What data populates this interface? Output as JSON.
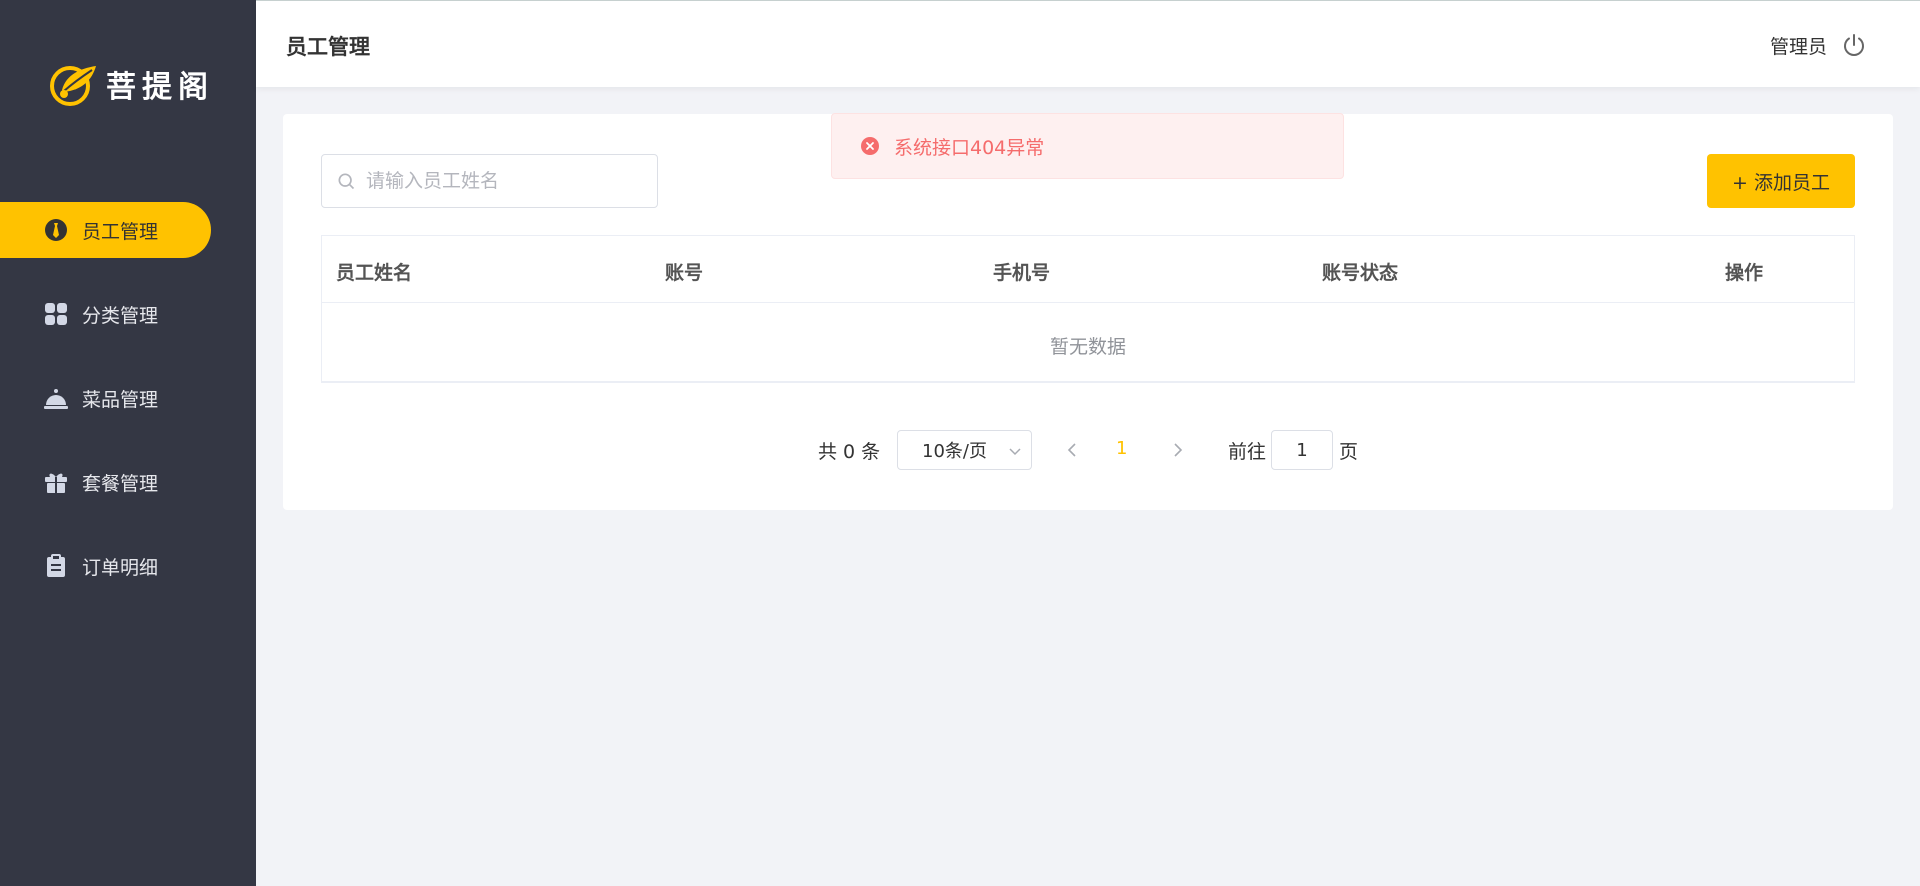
{
  "brand": {
    "name": "菩提阁",
    "accent": "#ffc200"
  },
  "sidebar": {
    "items": [
      {
        "label": "员工管理",
        "icon": "tie-icon",
        "active": true
      },
      {
        "label": "分类管理",
        "icon": "grid-icon",
        "active": false
      },
      {
        "label": "菜品管理",
        "icon": "cloche-icon",
        "active": false
      },
      {
        "label": "套餐管理",
        "icon": "gift-icon",
        "active": false
      },
      {
        "label": "订单明细",
        "icon": "clipboard-icon",
        "active": false
      }
    ]
  },
  "header": {
    "title": "员工管理",
    "user": "管理员",
    "logout_icon": "power-icon"
  },
  "toolbar": {
    "search_placeholder": "请输入员工姓名",
    "search_value": "",
    "add_label": "+ 添加员工"
  },
  "table": {
    "columns": [
      "员工姓名",
      "账号",
      "手机号",
      "账号状态",
      "操作"
    ],
    "rows": [],
    "empty_text": "暂无数据"
  },
  "pagination": {
    "total_text": "共 0 条",
    "page_size": "10条/页",
    "current_page": "1",
    "goto_label": "前往",
    "goto_value": "1",
    "goto_unit": "页"
  },
  "toast": {
    "type": "error",
    "message": "系统接口404异常"
  }
}
